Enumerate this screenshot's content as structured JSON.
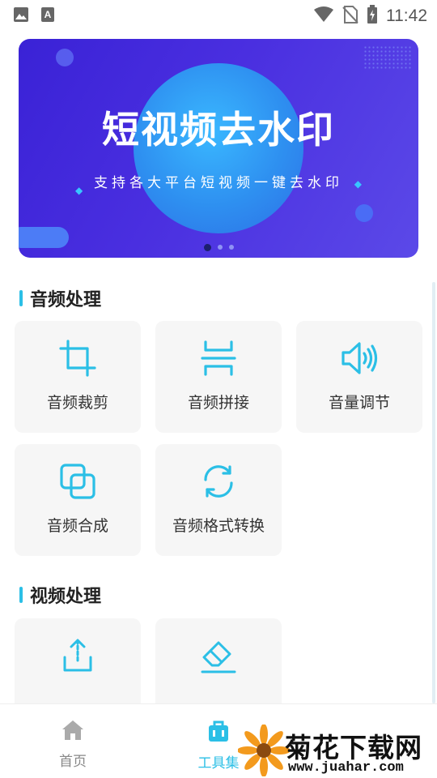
{
  "status_bar": {
    "time": "11:42",
    "left_icons": [
      "image-icon",
      "font-icon"
    ],
    "right_icons": [
      "wifi-icon",
      "no-sim-icon",
      "battery-charging-icon"
    ]
  },
  "banner": {
    "title": "短视频去水印",
    "subtitle": "支持各大平台短视频一键去水印",
    "page_count": 3,
    "active_page": 1
  },
  "sections": {
    "audio": {
      "title": "音频处理",
      "tools": [
        {
          "label": "音频裁剪",
          "icon": "crop-icon"
        },
        {
          "label": "音频拼接",
          "icon": "join-icon"
        },
        {
          "label": "音量调节",
          "icon": "speaker-icon"
        },
        {
          "label": "音频合成",
          "icon": "merge-icon"
        },
        {
          "label": "音频格式转换",
          "icon": "convert-icon"
        }
      ]
    },
    "video": {
      "title": "视频处理",
      "tools": [
        {
          "label": "",
          "icon": "upload-icon"
        },
        {
          "label": "",
          "icon": "eraser-icon"
        }
      ]
    }
  },
  "bottom_nav": {
    "items": [
      {
        "label": "首页",
        "icon": "home-icon",
        "active": false
      },
      {
        "label": "工具集",
        "icon": "toolbox-icon",
        "active": true
      }
    ]
  },
  "watermark": {
    "title": "菊花下载网",
    "url": "www.juahar.com"
  },
  "colors": {
    "accent": "#2bbfe6",
    "banner_bg": "#4a2fe0",
    "nav_active": "#2bbfe6",
    "nav_inactive": "#888888"
  }
}
